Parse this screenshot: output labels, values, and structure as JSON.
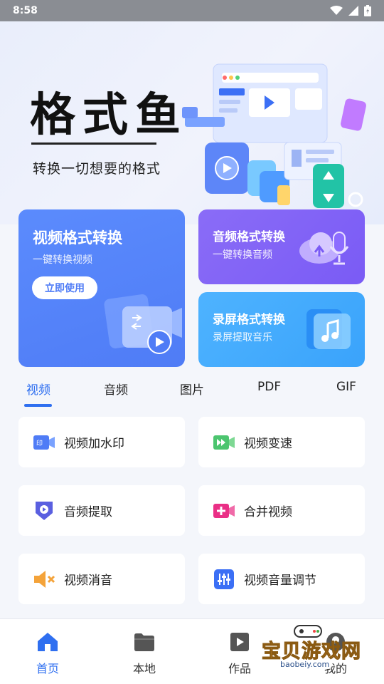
{
  "status_bar": {
    "time": "8:58"
  },
  "hero": {
    "title": "格式鱼",
    "subtitle": "转换一切想要的格式"
  },
  "cards": {
    "video": {
      "title": "视频格式转换",
      "subtitle": "一键转换视频",
      "button": "立即使用"
    },
    "audio": {
      "title": "音频格式转换",
      "subtitle": "一键转换音频"
    },
    "record": {
      "title": "录屏格式转换",
      "subtitle": "录屏提取音乐"
    }
  },
  "tabs": [
    {
      "label": "视频"
    },
    {
      "label": "音频"
    },
    {
      "label": "图片"
    },
    {
      "label": "PDF"
    },
    {
      "label": "GIF"
    }
  ],
  "tiles": [
    {
      "label": "视频加水印",
      "icon": "video-watermark-icon"
    },
    {
      "label": "视频变速",
      "icon": "video-speed-icon"
    },
    {
      "label": "音频提取",
      "icon": "audio-extract-icon"
    },
    {
      "label": "合并视频",
      "icon": "merge-video-icon"
    },
    {
      "label": "视频消音",
      "icon": "mute-video-icon"
    },
    {
      "label": "视频音量调节",
      "icon": "volume-adjust-icon"
    }
  ],
  "bottom_nav": [
    {
      "label": "首页",
      "icon": "home-icon"
    },
    {
      "label": "本地",
      "icon": "folder-icon"
    },
    {
      "label": "作品",
      "icon": "play-icon"
    },
    {
      "label": "我的",
      "icon": "user-icon"
    }
  ],
  "watermark": {
    "text": "宝贝游戏网",
    "url": "baobeiy.com"
  },
  "colors": {
    "accent": "#2f6ff0",
    "video_card": "#5b8bfd",
    "audio_card": "#8a6cf7",
    "record_card": "#4eb3ff"
  }
}
